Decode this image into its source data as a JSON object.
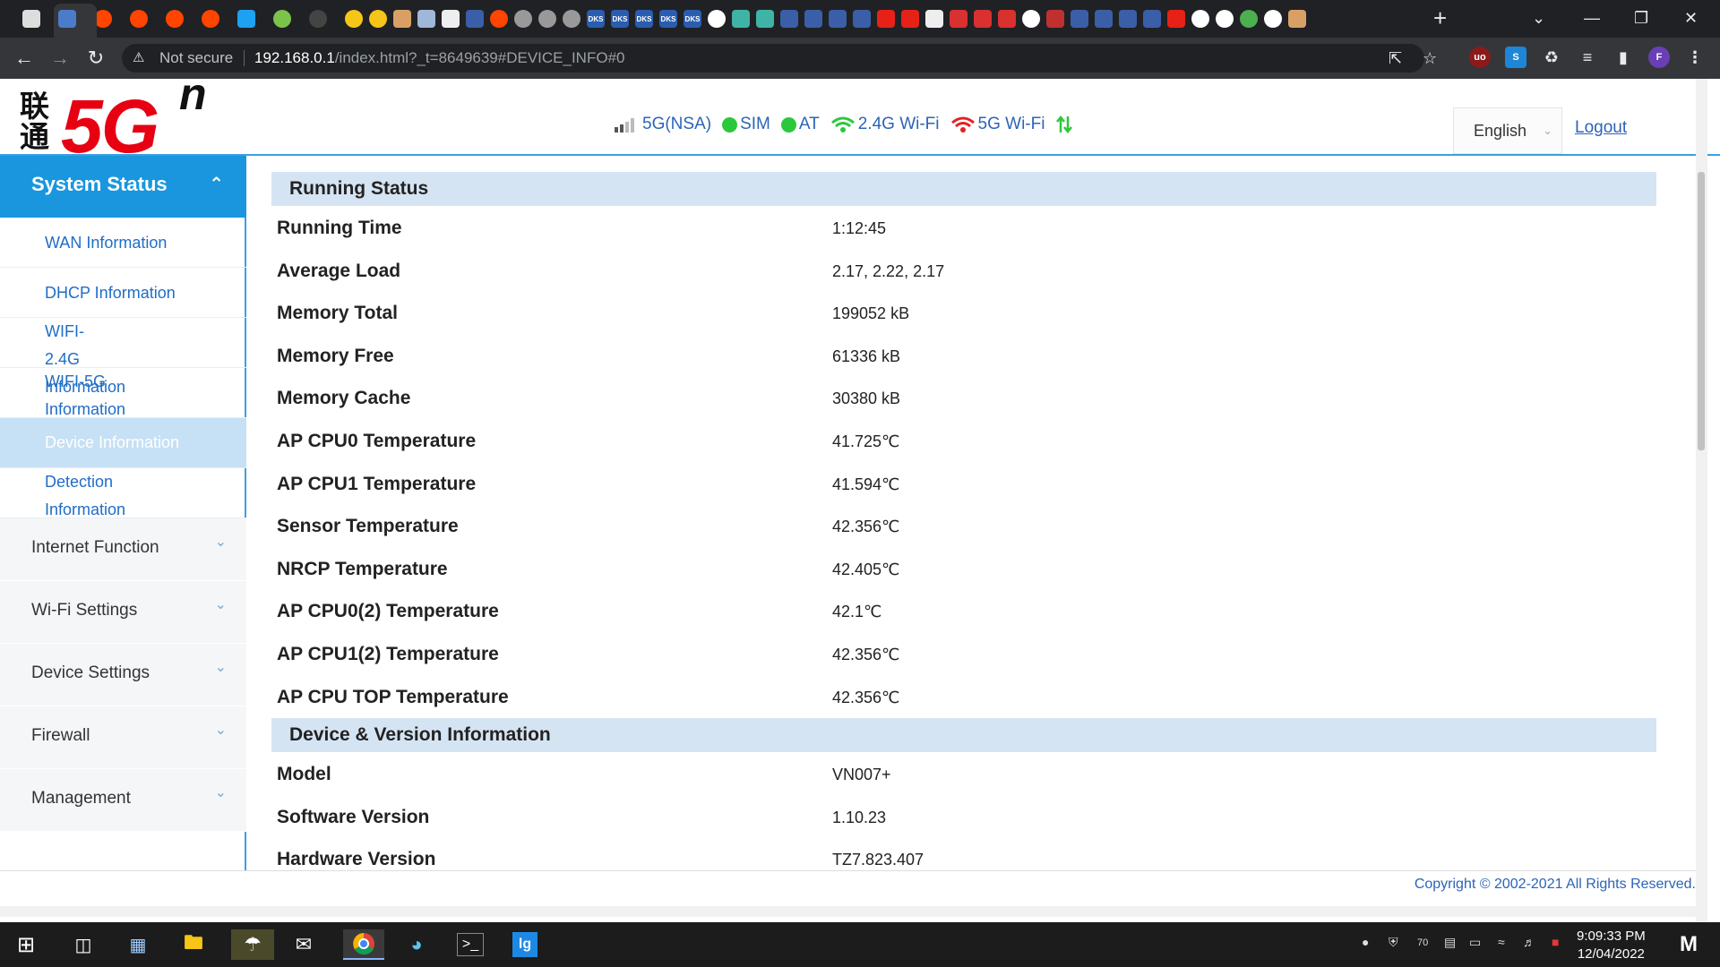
{
  "browser": {
    "not_secure": "Not secure",
    "url_host": "192.168.0.1",
    "url_path": "/index.html?_t=8649639#DEVICE_INFO#0",
    "profile_initial": "F"
  },
  "header": {
    "logo_cn": "联通",
    "logo_5g": "5G",
    "logo_n": "n",
    "status": {
      "network": "5G(NSA)",
      "sim": "SIM",
      "at": "AT",
      "wifi24": "2.4G Wi-Fi",
      "wifi5": "5G Wi-Fi"
    },
    "language": "English",
    "logout": "Logout"
  },
  "sidebar": {
    "system_status": "System Status",
    "sub_items": [
      {
        "label": "WAN Information"
      },
      {
        "label": "DHCP Information"
      },
      {
        "label": "WIFI-2.4G Information"
      },
      {
        "label": "WIFI-5G Information"
      },
      {
        "label": "Device Information"
      },
      {
        "label": "Detection Information"
      }
    ],
    "sections": [
      {
        "label": "Internet Function"
      },
      {
        "label": "Wi-Fi Settings"
      },
      {
        "label": "Device Settings"
      },
      {
        "label": "Firewall"
      },
      {
        "label": "Management"
      }
    ]
  },
  "running_status": {
    "title": "Running Status",
    "rows": [
      {
        "label": "Running Time",
        "value": "1:12:45"
      },
      {
        "label": "Average Load",
        "value": "2.17, 2.22, 2.17"
      },
      {
        "label": "Memory Total",
        "value": "199052 kB"
      },
      {
        "label": "Memory Free",
        "value": "61336 kB"
      },
      {
        "label": "Memory Cache",
        "value": "30380 kB"
      },
      {
        "label": "AP CPU0 Temperature",
        "value": "41.725℃"
      },
      {
        "label": "AP CPU1 Temperature",
        "value": "41.594℃"
      },
      {
        "label": "Sensor Temperature",
        "value": "42.356℃"
      },
      {
        "label": "NRCP Temperature",
        "value": "42.405℃"
      },
      {
        "label": "AP CPU0(2) Temperature",
        "value": "42.1℃"
      },
      {
        "label": "AP CPU1(2) Temperature",
        "value": "42.356℃"
      },
      {
        "label": "AP CPU TOP Temperature",
        "value": "42.356℃"
      }
    ]
  },
  "device_version": {
    "title": "Device & Version Information",
    "rows": [
      {
        "label": "Model",
        "value": "VN007+"
      },
      {
        "label": "Software Version",
        "value": "1.10.23"
      },
      {
        "label": "Hardware Version",
        "value": "TZ7.823.407"
      }
    ]
  },
  "footer": {
    "copyright": "Copyright © 2002-2021 All Rights Reserved."
  },
  "taskbar": {
    "time": "9:09:33 PM",
    "date": "12/04/2022",
    "tray_count": "70"
  }
}
